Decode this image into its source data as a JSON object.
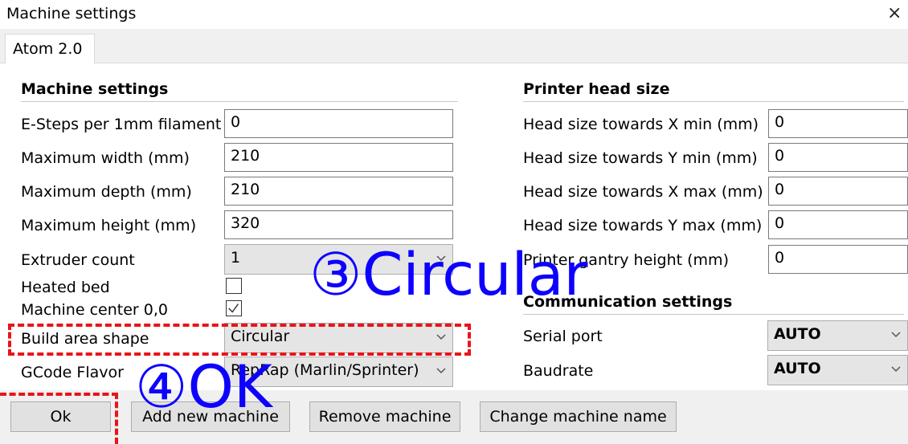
{
  "window": {
    "title": "Machine settings",
    "close_glyph": "×"
  },
  "tab": {
    "label": "Atom 2.0"
  },
  "machine": {
    "heading": "Machine settings",
    "esteps_label": "E-Steps per 1mm filament",
    "esteps_value": "0",
    "width_label": "Maximum width (mm)",
    "width_value": "210",
    "depth_label": "Maximum depth (mm)",
    "depth_value": "210",
    "height_label": "Maximum height (mm)",
    "height_value": "320",
    "extruder_label": "Extruder count",
    "extruder_value": "1",
    "heated_label": "Heated bed",
    "heated_checked": false,
    "center_label": "Machine center 0,0",
    "center_checked": true,
    "shape_label": "Build area shape",
    "shape_value": "Circular",
    "gcode_label": "GCode Flavor",
    "gcode_value": "RepRap (Marlin/Sprinter)"
  },
  "head": {
    "heading": "Printer head size",
    "xmin_label": "Head size towards X min (mm)",
    "xmin_value": "0",
    "ymin_label": "Head size towards Y min (mm)",
    "ymin_value": "0",
    "xmax_label": "Head size towards X max (mm)",
    "xmax_value": "0",
    "ymax_label": "Head size towards Y max (mm)",
    "ymax_value": "0",
    "gantry_label": "Printer gantry height (mm)",
    "gantry_value": "0"
  },
  "comm": {
    "heading": "Communication settings",
    "serial_label": "Serial port",
    "serial_value": "AUTO",
    "baud_label": "Baudrate",
    "baud_value": "AUTO"
  },
  "buttons": {
    "ok": "Ok",
    "add": "Add new machine",
    "remove": "Remove machine",
    "rename": "Change machine name"
  },
  "annotations": {
    "step3": "③Circular",
    "step4": "④OK",
    "annotation_color": "#0d00ff",
    "highlight_color": "#e8141a"
  },
  "icons": {
    "dropdown": "chevron-down-icon",
    "check": "checkmark-icon",
    "close": "close-icon"
  }
}
